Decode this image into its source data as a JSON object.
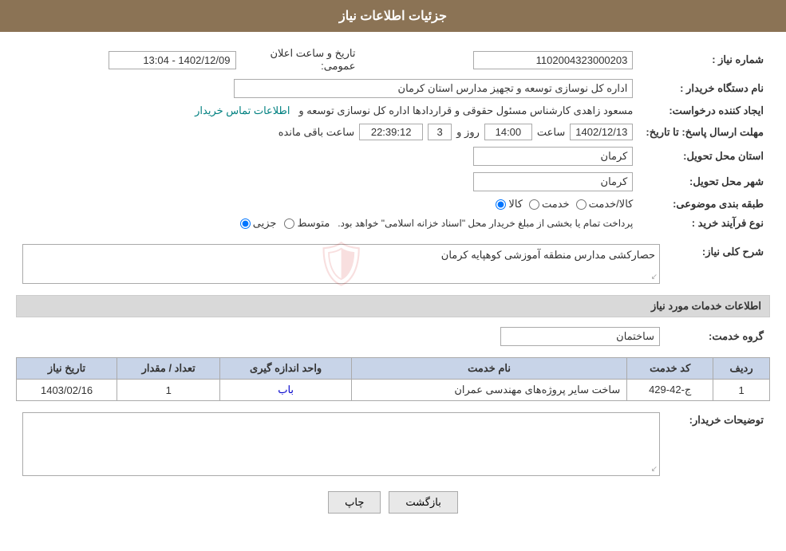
{
  "header": {
    "title": "جزئیات اطلاعات نیاز"
  },
  "fields": {
    "shomara_niaz_label": "شماره نیاز :",
    "shomara_niaz_value": "1102004323000203",
    "nam_dastgah_label": "نام دستگاه خریدار :",
    "nam_dastgah_value": "اداره کل نوسازی  توسعه و تجهیز مدارس استان کرمان",
    "ijad_konande_label": "ایجاد کننده درخواست:",
    "ijad_konande_value": "مسعود زاهدی کارشناس مسئول حقوقی و قراردادها اداره کل نوسازی  توسعه و",
    "ijad_konande_link": "اطلاعات تماس خریدار",
    "mohlat_label": "مهلت ارسال پاسخ: تا تاریخ:",
    "date_value": "1402/12/13",
    "saat_label": "ساعت",
    "saat_value": "14:00",
    "roz_label": "روز و",
    "roz_value": "3",
    "baghi_label": "ساعت باقی مانده",
    "baghi_value": "22:39:12",
    "tarikh_elan_label": "تاریخ و ساعت اعلان عمومی:",
    "tarikh_elan_value": "1402/12/09 - 13:04",
    "ostan_label": "استان محل تحویل:",
    "ostan_value": "کرمان",
    "shahr_label": "شهر محل تحویل:",
    "shahr_value": "کرمان",
    "tabaqe_label": "طبقه بندی موضوعی:",
    "tabaqe_kala": "کالا",
    "tabaqe_khedmat": "خدمت",
    "tabaqe_kala_khedmat": "کالا/خدمت",
    "noeFarayand_label": "نوع فرآیند خرید :",
    "noeFarayand_jozii": "جزیی",
    "noeFarayand_mottavasset": "متوسط",
    "noeFarayand_notice": "پرداخت تمام یا بخشی از مبلغ خریدار محل \"اسناد خزانه اسلامی\" خواهد بود.",
    "sharh_label": "شرح کلی نیاز:",
    "sharh_value": "حصارکشی مدارس منطقه آموزشی کوهپایه کرمان",
    "services_section": "اطلاعات خدمات مورد نیاز",
    "grohe_khedmat_label": "گروه خدمت:",
    "grohe_khedmat_value": "ساختمان",
    "table": {
      "headers": [
        "ردیف",
        "کد خدمت",
        "نام خدمت",
        "واحد اندازه گیری",
        "تعداد / مقدار",
        "تاریخ نیاز"
      ],
      "rows": [
        {
          "radif": "1",
          "code": "ج-42-429",
          "name": "ساخت سایر پروژه‌های مهندسی عمران",
          "unit": "باب",
          "count": "1",
          "date": "1403/02/16"
        }
      ]
    },
    "tosihaat_label": "توضیحات خریدار:",
    "btn_print": "چاپ",
    "btn_back": "بازگشت"
  }
}
